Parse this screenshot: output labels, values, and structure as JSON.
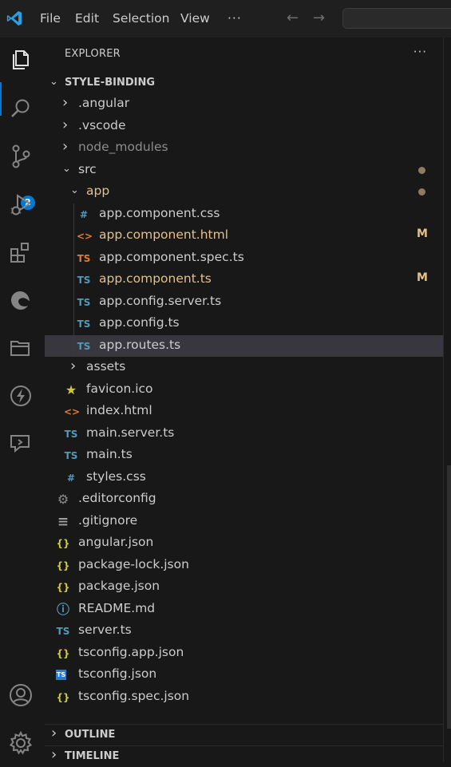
{
  "menu": [
    "File",
    "Edit",
    "Selection",
    "View"
  ],
  "menu_more": "···",
  "nav": {
    "back": "←",
    "forward": "→"
  },
  "activity": {
    "scm_badge": "2"
  },
  "explorer": {
    "title": "EXPLORER",
    "more": "···"
  },
  "workspace": "STYLE-BINDING",
  "tree": [
    {
      "name": ".angular",
      "type": "folder",
      "depth": 1,
      "expanded": false
    },
    {
      "name": ".vscode",
      "type": "folder",
      "depth": 1,
      "expanded": false
    },
    {
      "name": "node_modules",
      "type": "folder",
      "depth": 1,
      "expanded": false,
      "ignored": true
    },
    {
      "name": "src",
      "type": "folder",
      "depth": 1,
      "expanded": true,
      "dot": true
    },
    {
      "name": "app",
      "type": "folder",
      "depth": 2,
      "expanded": true,
      "dot": true,
      "modified": true
    },
    {
      "name": "app.component.css",
      "type": "css",
      "depth": 3
    },
    {
      "name": "app.component.html",
      "type": "html",
      "depth": 3,
      "modified": true,
      "status": "M"
    },
    {
      "name": "app.component.spec.ts",
      "type": "ts-spec",
      "depth": 3
    },
    {
      "name": "app.component.ts",
      "type": "ts",
      "depth": 3,
      "modified": true,
      "status": "M"
    },
    {
      "name": "app.config.server.ts",
      "type": "ts",
      "depth": 3
    },
    {
      "name": "app.config.ts",
      "type": "ts",
      "depth": 3
    },
    {
      "name": "app.routes.ts",
      "type": "ts",
      "depth": 3,
      "selected": true
    },
    {
      "name": "assets",
      "type": "folder",
      "depth": 2,
      "expanded": false
    },
    {
      "name": "favicon.ico",
      "type": "star",
      "depth": 2
    },
    {
      "name": "index.html",
      "type": "html",
      "depth": 2
    },
    {
      "name": "main.server.ts",
      "type": "ts",
      "depth": 2
    },
    {
      "name": "main.ts",
      "type": "ts",
      "depth": 2
    },
    {
      "name": "styles.css",
      "type": "css",
      "depth": 2
    },
    {
      "name": ".editorconfig",
      "type": "gear",
      "depth": 1
    },
    {
      "name": ".gitignore",
      "type": "lines",
      "depth": 1
    },
    {
      "name": "angular.json",
      "type": "json",
      "depth": 1
    },
    {
      "name": "package-lock.json",
      "type": "json",
      "depth": 1
    },
    {
      "name": "package.json",
      "type": "json",
      "depth": 1
    },
    {
      "name": "README.md",
      "type": "info",
      "depth": 1
    },
    {
      "name": "server.ts",
      "type": "ts",
      "depth": 1
    },
    {
      "name": "tsconfig.app.json",
      "type": "json",
      "depth": 1
    },
    {
      "name": "tsconfig.json",
      "type": "tsconfig",
      "depth": 1
    },
    {
      "name": "tsconfig.spec.json",
      "type": "json",
      "depth": 1
    }
  ],
  "sections": [
    {
      "label": "OUTLINE"
    },
    {
      "label": "TIMELINE"
    }
  ],
  "colors": {
    "accent": "#0078d4",
    "modified": "#e2c08d",
    "ts": "#519aba",
    "html": "#e37933",
    "json": "#cbcb41",
    "css": "#519aba"
  }
}
